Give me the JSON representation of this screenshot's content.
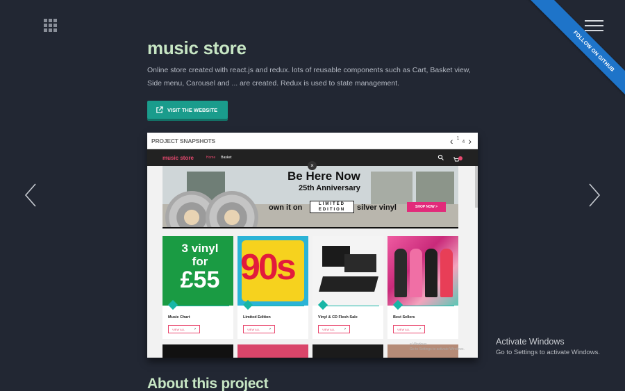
{
  "header": {
    "title": "music store",
    "description": "Online store created with react.js and redux. lots of reusable components such as Cart, Basket view, Side menu, Carousel and ... are created. Redux is used to state management.",
    "visit_label": "VISIT THE WEBSITE",
    "ribbon_label": "FOLLOW ON GITHUB"
  },
  "snapshots": {
    "title": "PROJECT SNAPSHOTS",
    "current_page": "1",
    "total_pages": "4"
  },
  "store": {
    "logo": "music store",
    "nav": [
      "Home",
      "Basket"
    ],
    "close_label": "×",
    "banner": {
      "headline": "Be Here Now",
      "subline": "25th Anniversary",
      "own": "own it on",
      "limited": "LIMITED EDITION",
      "silver": "silver vinyl",
      "shop": "SHOP NOW >"
    },
    "cards": [
      {
        "label": "Music Chart",
        "button": "VIEW ALL",
        "art_line1": "3 vinyl",
        "art_line2": "for",
        "art_big": "£55"
      },
      {
        "label": "Limited Edition",
        "button": "VIEW ALL",
        "art_big": "90s"
      },
      {
        "label": "Vinyl & CD Flesh Sale",
        "button": "VIEW ALL"
      },
      {
        "label": "Best Sellers",
        "button": "VIEW ALL"
      }
    ]
  },
  "inner_activate": {
    "line1": "e Windows",
    "line2": "Go to Settings to activate Windows."
  },
  "about_heading": "About this project",
  "windows_watermark": {
    "line1": "Activate Windows",
    "line2": "Go to Settings to activate Windows."
  },
  "colors": {
    "background": "#222733",
    "title": "#c7e6c4",
    "accent_teal": "#1a9c8c",
    "ribbon_blue": "#1e74c9",
    "store_pink": "#e9496f"
  },
  "icons": {
    "grid": "grid-menu-icon",
    "hamburger": "hamburger-menu-icon",
    "external": "external-link-icon",
    "prev": "chevron-left-icon",
    "next": "chevron-right-icon",
    "search": "search-icon",
    "cart": "cart-icon"
  }
}
